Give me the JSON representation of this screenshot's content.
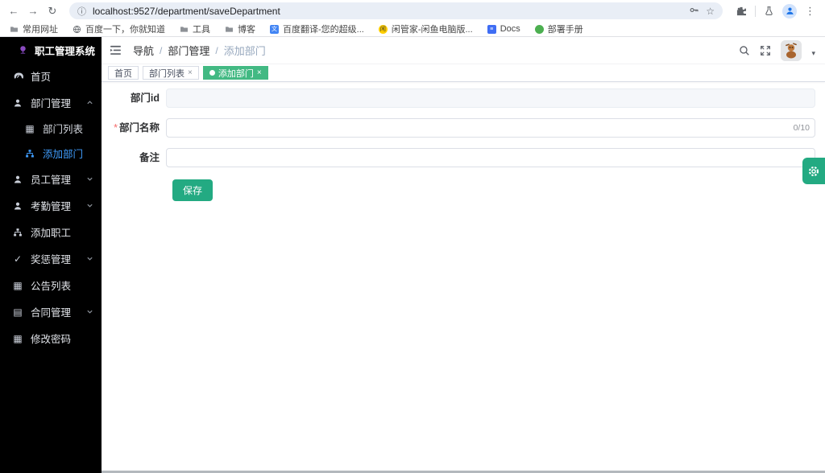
{
  "browser": {
    "url": "localhost:9527/department/saveDepartment",
    "bookmarks": [
      {
        "label": "常用网址",
        "icon": "folder"
      },
      {
        "label": "百度一下，你就知道",
        "icon": "globe"
      },
      {
        "label": "工具",
        "icon": "folder"
      },
      {
        "label": "博客",
        "icon": "folder"
      },
      {
        "label": "百度翻译-您的超级...",
        "icon": "translate-favicon"
      },
      {
        "label": "闲管家-闲鱼电脑版...",
        "icon": "yellow-favicon"
      },
      {
        "label": "Docs",
        "icon": "docs-favicon"
      },
      {
        "label": "部署手册",
        "icon": "green-favicon"
      }
    ]
  },
  "sidebar": {
    "title": "职工管理系统",
    "items": [
      {
        "label": "首页",
        "icon": "dashboard-icon"
      },
      {
        "label": "部门管理",
        "icon": "user-icon",
        "expanded": true
      },
      {
        "label": "部门列表",
        "icon": "table-icon",
        "submenu": true
      },
      {
        "label": "添加部门",
        "icon": "tree-icon",
        "submenu": true,
        "active": true
      },
      {
        "label": "员工管理",
        "icon": "user-icon",
        "expanded": false
      },
      {
        "label": "考勤管理",
        "icon": "user-icon",
        "expanded": false
      },
      {
        "label": "添加职工",
        "icon": "tree-icon"
      },
      {
        "label": "奖惩管理",
        "icon": "check-icon",
        "expanded": false
      },
      {
        "label": "公告列表",
        "icon": "table-icon"
      },
      {
        "label": "合同管理",
        "icon": "document-icon",
        "expanded": false
      },
      {
        "label": "修改密码",
        "icon": "table-icon"
      }
    ]
  },
  "breadcrumb": {
    "items": [
      "导航",
      "部门管理",
      "添加部门"
    ],
    "separator": "/"
  },
  "tabs": [
    {
      "label": "首页",
      "closable": false,
      "active": false
    },
    {
      "label": "部门列表",
      "closable": true,
      "active": false
    },
    {
      "label": "添加部门",
      "closable": true,
      "active": true
    }
  ],
  "form": {
    "fields": [
      {
        "label": "部门id",
        "value": "",
        "placeholder": "",
        "disabled": true
      },
      {
        "label": "部门名称",
        "value": "",
        "placeholder": "",
        "required_mark": "*",
        "counter": "0/10"
      },
      {
        "label": "备注",
        "value": "",
        "placeholder": ""
      }
    ],
    "save_label": "保存"
  },
  "glyphs": {
    "back": "←",
    "forward": "→",
    "reload": "↻",
    "site_info": "ⓘ",
    "star": "☆",
    "menu_dots": "⋮",
    "caret_down": "▾",
    "tab_close": "×",
    "table": "▦",
    "document": "▤",
    "check": "✓"
  },
  "colors": {
    "active_tab": "#42b983",
    "accent_green": "#23aa82",
    "active_menu": "#409eff",
    "sidebar_bg": "#000000"
  }
}
